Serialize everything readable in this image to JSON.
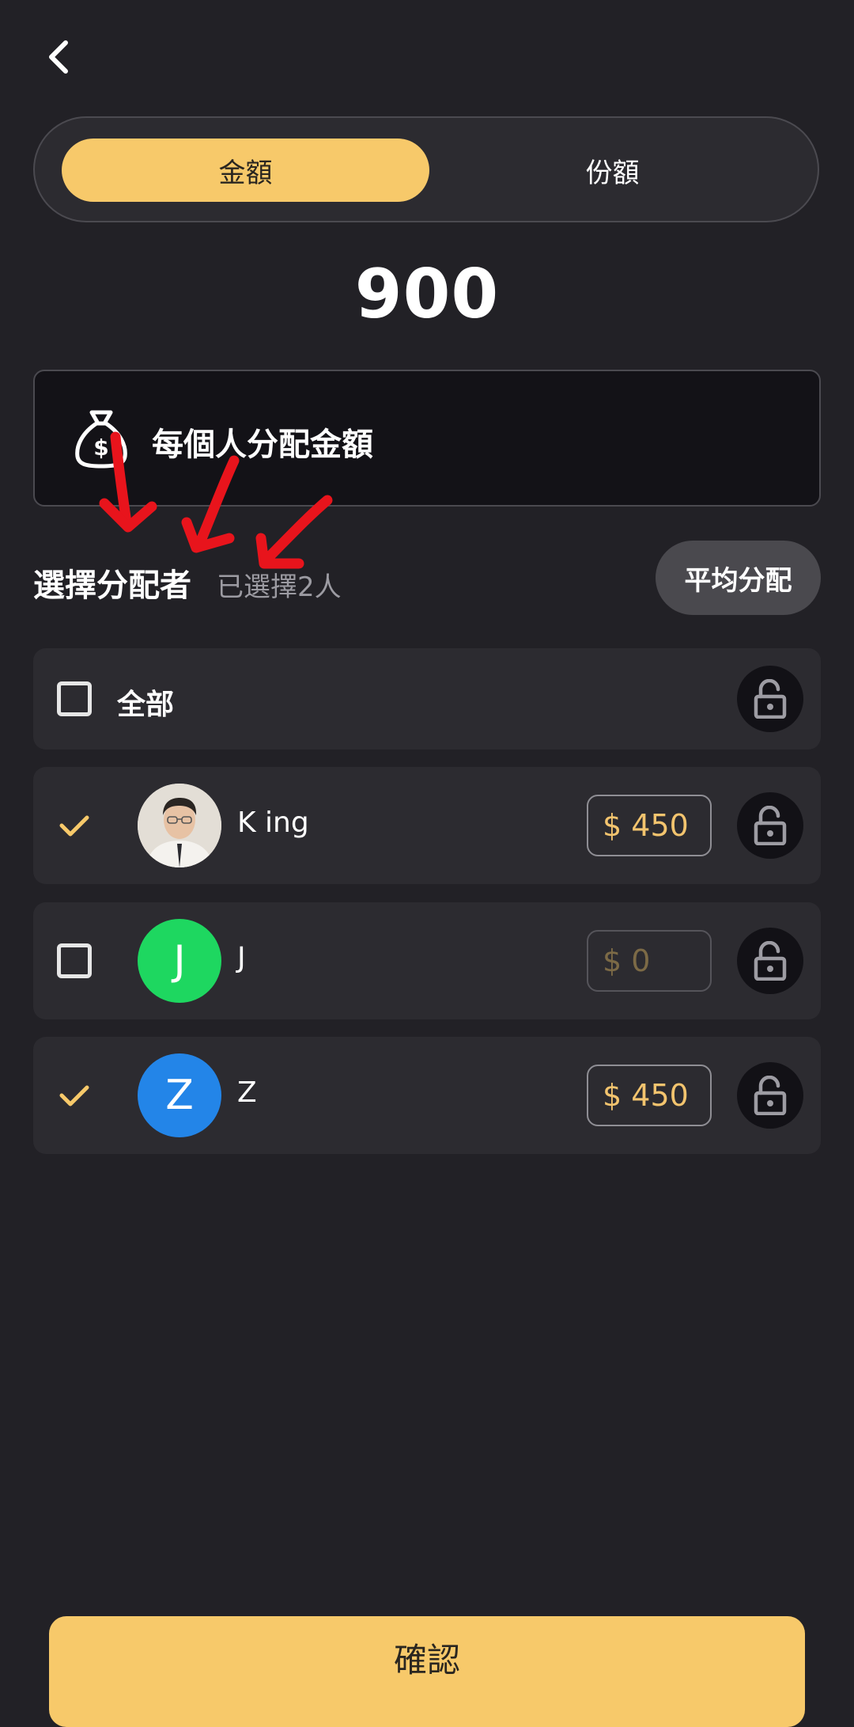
{
  "header": {
    "back_icon": "chevron-left-icon"
  },
  "toggle": {
    "amount_label": "金額",
    "share_label": "份額",
    "selected": "amount"
  },
  "total": "900",
  "per_person": {
    "icon": "money-bag-icon",
    "label": "每個人分配金額"
  },
  "selection": {
    "title": "選擇分配者",
    "count_text": "已選擇2人",
    "avg_button": "平均分配"
  },
  "all_row": {
    "label": "全部",
    "checked": false
  },
  "people": [
    {
      "name": "K ing",
      "checked": true,
      "amount": "450",
      "currency": "$",
      "avatar": "photo"
    },
    {
      "name": "J",
      "checked": false,
      "amount": "0",
      "currency": "$",
      "avatar_letter": "J",
      "avatar_color": "#1ed760"
    },
    {
      "name": "Z",
      "checked": true,
      "amount": "450",
      "currency": "$",
      "avatar_letter": "Z",
      "avatar_color": "#2385e8"
    }
  ],
  "confirm_label": "確認",
  "colors": {
    "accent": "#f7c96a",
    "background": "#222126",
    "annotation_red": "#e8141c"
  }
}
